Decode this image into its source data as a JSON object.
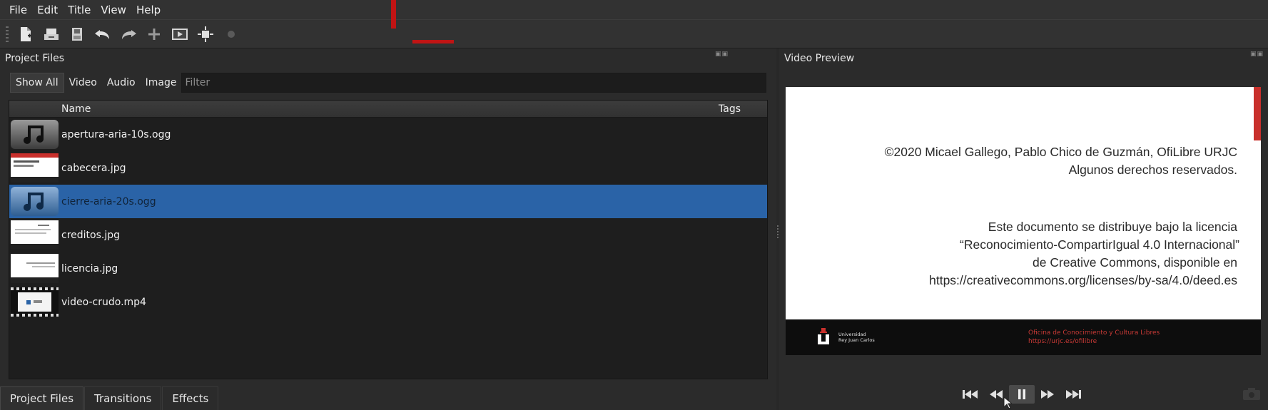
{
  "menu": [
    {
      "id": "file",
      "label": "File"
    },
    {
      "id": "edit",
      "label": "Edit"
    },
    {
      "id": "title",
      "label": "Title"
    },
    {
      "id": "view",
      "label": "View"
    },
    {
      "id": "help",
      "label": "Help"
    }
  ],
  "toolbar": {
    "buttons": [
      "new-project-icon",
      "open-project-icon",
      "save-project-icon",
      "undo-icon",
      "redo-icon",
      "import-files-icon",
      "preview-icon",
      "export-video-icon",
      "record-icon"
    ]
  },
  "project_files": {
    "title": "Project Files",
    "filters": [
      "Show All",
      "Video",
      "Audio",
      "Image"
    ],
    "active_filter": "Show All",
    "filter_placeholder": "Filter",
    "columns": {
      "name": "Name",
      "tags": "Tags"
    },
    "files": [
      {
        "name": "apertura-aria-10s.ogg",
        "type": "audio",
        "selected": false
      },
      {
        "name": "cabecera.jpg",
        "type": "image",
        "selected": false
      },
      {
        "name": "cierre-aria-20s.ogg",
        "type": "audio",
        "selected": true
      },
      {
        "name": "creditos.jpg",
        "type": "image",
        "selected": false
      },
      {
        "name": "licencia.jpg",
        "type": "image",
        "selected": false
      },
      {
        "name": "video-crudo.mp4",
        "type": "video",
        "selected": false
      }
    ]
  },
  "bottom_tabs": [
    {
      "label": "Project Files",
      "active": true
    },
    {
      "label": "Transitions",
      "active": false
    },
    {
      "label": "Effects",
      "active": false
    }
  ],
  "video_preview": {
    "title": "Video Preview",
    "copyright_line1": "©2020 Micael Gallego, Pablo Chico de Guzmán, OfiLibre URJC",
    "copyright_line2": "Algunos derechos reservados.",
    "license_line1": "Este documento se distribuye bajo la licencia",
    "license_line2": "“Reconocimiento-CompartirIgual 4.0 Internacional”",
    "license_line3": "de Creative Commons, disponible en",
    "license_line4": "https://creativecommons.org/licenses/by-sa/4.0/deed.es",
    "university_line1": "Universidad",
    "university_line2": "Rey Juan Carlos",
    "office_line1": "Oficina de Conocimiento y Cultura Libres",
    "office_line2": "https://urjc.es/ofilibre"
  },
  "transport": [
    "jump-start-icon",
    "rewind-icon",
    "pause-icon",
    "fast-forward-icon",
    "jump-end-icon"
  ],
  "colors": {
    "accent_selection": "#2a63a7",
    "brand_red": "#c9302c"
  }
}
